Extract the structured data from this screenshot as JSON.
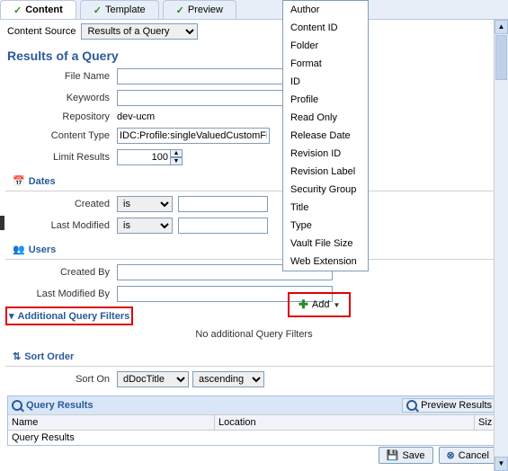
{
  "tabs": {
    "content": "Content",
    "template": "Template",
    "preview": "Preview"
  },
  "content_source": {
    "label": "Content Source",
    "value": "Results of a Query"
  },
  "section_title": "Results of a Query",
  "fields": {
    "file_name": {
      "label": "File Name",
      "value": ""
    },
    "keywords": {
      "label": "Keywords",
      "value": ""
    },
    "repository": {
      "label": "Repository",
      "value": "dev-ucm"
    },
    "content_type": {
      "label": "Content Type",
      "value": "IDC:Profile:singleValuedCustomFie"
    },
    "limit_results": {
      "label": "Limit Results",
      "value": "100"
    }
  },
  "dates": {
    "header": "Dates",
    "created": {
      "label": "Created",
      "op": "is",
      "value": ""
    },
    "modified": {
      "label": "Last Modified",
      "op": "is",
      "value": ""
    }
  },
  "users": {
    "header": "Users",
    "created_by": {
      "label": "Created By",
      "value": ""
    },
    "modified_by": {
      "label": "Last Modified By",
      "value": ""
    }
  },
  "filters": {
    "header": "Additional Query Filters",
    "add_label": "Add",
    "empty": "No additional Query Filters"
  },
  "sort": {
    "header": "Sort Order",
    "sort_on_label": "Sort On",
    "field": "dDocTitle",
    "direction": "ascending"
  },
  "results": {
    "header": "Query Results",
    "preview_label": "Preview Results",
    "col_name": "Name",
    "col_location": "Location",
    "col_size": "Siz",
    "body": "Query Results"
  },
  "footer": {
    "save": "Save",
    "cancel": "Cancel"
  },
  "dropdown": [
    "Author",
    "Content ID",
    "Folder",
    "Format",
    "ID",
    "Profile",
    "Read Only",
    "Release Date",
    "Revision ID",
    "Revision Label",
    "Security Group",
    "Title",
    "Type",
    "Vault File Size",
    "Web Extension"
  ]
}
